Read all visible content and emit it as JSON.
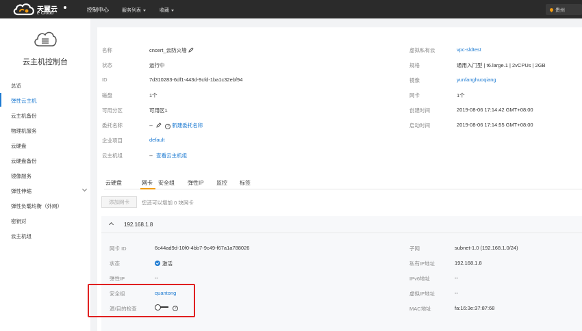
{
  "header": {
    "logo_cn": "天翼云",
    "logo_en": "e Cloud",
    "nav_console": "控制中心",
    "nav_services": "服务列表",
    "nav_favorites": "收藏",
    "region": "贵州"
  },
  "sidebar": {
    "title": "云主机控制台",
    "items": [
      {
        "label": "总览"
      },
      {
        "label": "弹性云主机"
      },
      {
        "label": "云主机备份"
      },
      {
        "label": "物理机服务"
      },
      {
        "label": "云硬盘"
      },
      {
        "label": "云硬盘备份"
      },
      {
        "label": "镜像服务"
      },
      {
        "label": "弹性伸缩"
      },
      {
        "label": "弹性负载均衡（外网）"
      },
      {
        "label": "密钥对"
      },
      {
        "label": "云主机组"
      }
    ]
  },
  "details": {
    "left": [
      {
        "label": "名称",
        "value": "cncert_云防火墙"
      },
      {
        "label": "状态",
        "value": "运行中"
      },
      {
        "label": "ID",
        "value": "7d310283-6df1-443d-9cfd-1ba1c32ebf94"
      },
      {
        "label": "磁盘",
        "value": "1个"
      },
      {
        "label": "可用分区",
        "value": "可用区1"
      },
      {
        "label": "委托名称",
        "value": "--",
        "link": "新建委托名称"
      },
      {
        "label": "企业项目",
        "value": "default"
      },
      {
        "label": "云主机组",
        "value": "--",
        "link": "查看云主机组"
      }
    ],
    "right": [
      {
        "label": "虚拟私有云",
        "value": "vpc-sldtest"
      },
      {
        "label": "规格",
        "value": "通用入门型 | t6.large.1 | 2vCPUs | 2GB"
      },
      {
        "label": "镜像",
        "value": "yunfanghuoqiang"
      },
      {
        "label": "网卡",
        "value": "1个"
      },
      {
        "label": "创建时间",
        "value": "2019-08-06 17:14:42 GMT+08:00"
      },
      {
        "label": "启动时间",
        "value": "2019-08-06 17:14:55 GMT+08:00"
      }
    ]
  },
  "tabs": [
    "云硬盘",
    "网卡",
    "安全组",
    "弹性IP",
    "监控",
    "标签"
  ],
  "active_tab": "网卡",
  "nic": {
    "add_button": "添加网卡",
    "hint": "您还可以增加 0 块网卡",
    "ip_header": "192.168.1.8",
    "left": [
      {
        "label": "网卡 ID",
        "value": "6c44ad9d-10f0-4bb7-9c49-f67a1a788026"
      },
      {
        "label": "状态",
        "value": "激活"
      },
      {
        "label": "弹性IP",
        "value": "--"
      },
      {
        "label": "安全组",
        "value": "quantong"
      },
      {
        "label": "源/目的检查",
        "value": ""
      }
    ],
    "right": [
      {
        "label": "子网",
        "value": "subnet-1.0 (192.168.1.0/24)"
      },
      {
        "label": "私有IP地址",
        "value": "192.168.1.8"
      },
      {
        "label": "IPv6地址",
        "value": "--"
      },
      {
        "label": "虚拟IP地址",
        "value": "--"
      },
      {
        "label": "MAC地址",
        "value": "fa:16:3e:37:87:68"
      }
    ]
  },
  "colors": {
    "accent": "#1e7bd2",
    "tab_underline": "#f39c12",
    "highlight": "#e02020"
  }
}
